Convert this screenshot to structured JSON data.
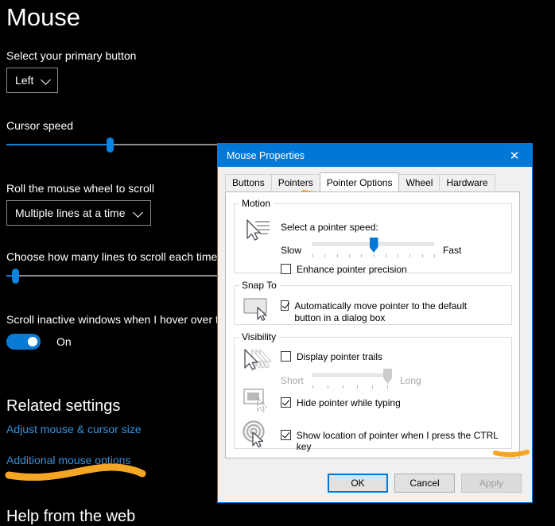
{
  "settings": {
    "page_title": "Mouse",
    "primary_button": {
      "label": "Select your primary button",
      "value": "Left",
      "chevron_icon": "chevron-down-icon"
    },
    "cursor_speed": {
      "label": "Cursor speed",
      "value_percent": 46
    },
    "wheel_scroll": {
      "label": "Roll the mouse wheel to scroll",
      "value": "Multiple lines at a time",
      "chevron_icon": "chevron-down-icon"
    },
    "lines_to_scroll": {
      "label": "Choose how many lines to scroll each time",
      "value_percent": 4
    },
    "scroll_inactive": {
      "label": "Scroll inactive windows when I hover over them",
      "state": "On"
    },
    "related_settings": {
      "heading": "Related settings",
      "links": [
        "Adjust mouse & cursor size",
        "Additional mouse options"
      ]
    },
    "help": {
      "heading": "Help from the web"
    },
    "accent_color": "#0a84e0",
    "link_color": "#3b8fd6",
    "marker_color": "#f5a623"
  },
  "dialog": {
    "title": "Mouse Properties",
    "close_icon": "close-icon",
    "tabs": [
      {
        "label": "Buttons",
        "selected": false
      },
      {
        "label": "Pointers",
        "selected": false
      },
      {
        "label": "Pointer Options",
        "selected": true
      },
      {
        "label": "Wheel",
        "selected": false
      },
      {
        "label": "Hardware",
        "selected": false
      }
    ],
    "motion": {
      "legend": "Motion",
      "icon": "pointer-speed-icon",
      "prompt": "Select a pointer speed:",
      "slider_min_label": "Slow",
      "slider_max_label": "Fast",
      "slider_value_percent": 50,
      "slider_tick_count": 11,
      "enhance_precision": {
        "label": "Enhance pointer precision",
        "checked": false
      }
    },
    "snap_to": {
      "legend": "Snap To",
      "icon": "snap-to-button-icon",
      "auto_move": {
        "label": "Automatically move pointer to the default button in a dialog box",
        "checked": true
      }
    },
    "visibility": {
      "legend": "Visibility",
      "trails": {
        "icon": "pointer-trails-icon",
        "label": "Display pointer trails",
        "checked": false,
        "slider_min_label": "Short",
        "slider_max_label": "Long",
        "slider_value_percent": 90,
        "slider_tick_count": 6,
        "disabled": true
      },
      "hide_while_typing": {
        "icon": "hide-pointer-typing-icon",
        "label": "Hide pointer while typing",
        "checked": true
      },
      "show_location": {
        "icon": "show-pointer-location-icon",
        "label": "Show location of pointer when I press the CTRL key",
        "checked": true
      }
    },
    "buttons": {
      "ok": "OK",
      "cancel": "Cancel",
      "apply": "Apply"
    },
    "title_bar_color": "#0078d7"
  }
}
